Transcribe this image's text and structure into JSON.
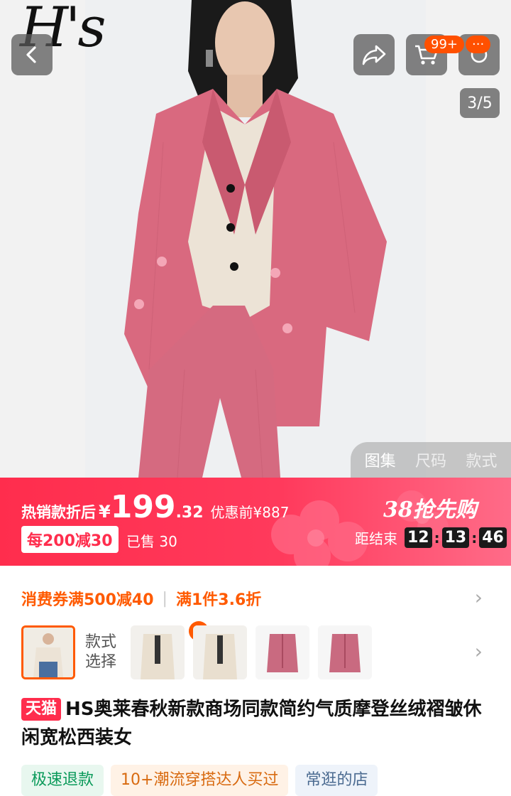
{
  "hero": {
    "brand": "H's",
    "cart_badge": "99+",
    "more_badge": "···",
    "image_counter": "3/5",
    "gallery_tabs": [
      "图集",
      "尺码",
      "款式"
    ]
  },
  "promo": {
    "label": "热销款折后",
    "currency": "¥",
    "price_int": "199",
    "price_dec": ".32",
    "original": "优惠前¥887",
    "coupon": "每200减30",
    "sold": "已售 30",
    "event": "38抢先购",
    "countdown_label": "距结束",
    "hours": "12",
    "minutes": "13",
    "seconds": "46"
  },
  "coupons": {
    "first": "消费券满500减40",
    "second": "满1件3.6折"
  },
  "styles": {
    "label_line1": "款式",
    "label_line2": "选择"
  },
  "product": {
    "tag": "天猫",
    "title": "HS奥莱春秋新款商场同款简约气质摩登丝绒褶皱休闲宽松西装女"
  },
  "tags": [
    "极速退款",
    "10+潮流穿搭达人买过",
    "常逛的店"
  ],
  "colors": {
    "accent": "#ff2d4d",
    "orange": "#ff5a00",
    "suit_pink": "#d9697f"
  }
}
